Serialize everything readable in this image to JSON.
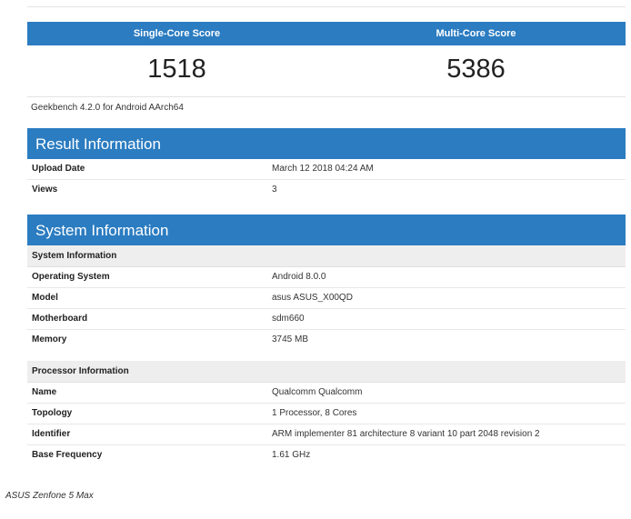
{
  "scores": {
    "single_label": "Single-Core Score",
    "multi_label": "Multi-Core Score",
    "single_value": "1518",
    "multi_value": "5386"
  },
  "version": "Geekbench 4.2.0 for Android AArch64",
  "result_info": {
    "title": "Result Information",
    "rows": [
      {
        "key": "Upload Date",
        "value": "March 12 2018 04:24 AM"
      },
      {
        "key": "Views",
        "value": "3"
      }
    ]
  },
  "system_info": {
    "title": "System Information",
    "system_subheader": "System Information",
    "system_rows": [
      {
        "key": "Operating System",
        "value": "Android 8.0.0"
      },
      {
        "key": "Model",
        "value": "asus ASUS_X00QD"
      },
      {
        "key": "Motherboard",
        "value": "sdm660"
      },
      {
        "key": "Memory",
        "value": "3745 MB"
      }
    ],
    "processor_subheader": "Processor Information",
    "processor_rows": [
      {
        "key": "Name",
        "value": "Qualcomm Qualcomm"
      },
      {
        "key": "Topology",
        "value": "1 Processor, 8 Cores"
      },
      {
        "key": "Identifier",
        "value": "ARM implementer 81 architecture 8 variant 10 part 2048 revision 2"
      },
      {
        "key": "Base Frequency",
        "value": "1.61 GHz"
      }
    ]
  },
  "caption": "ASUS Zenfone 5 Max"
}
